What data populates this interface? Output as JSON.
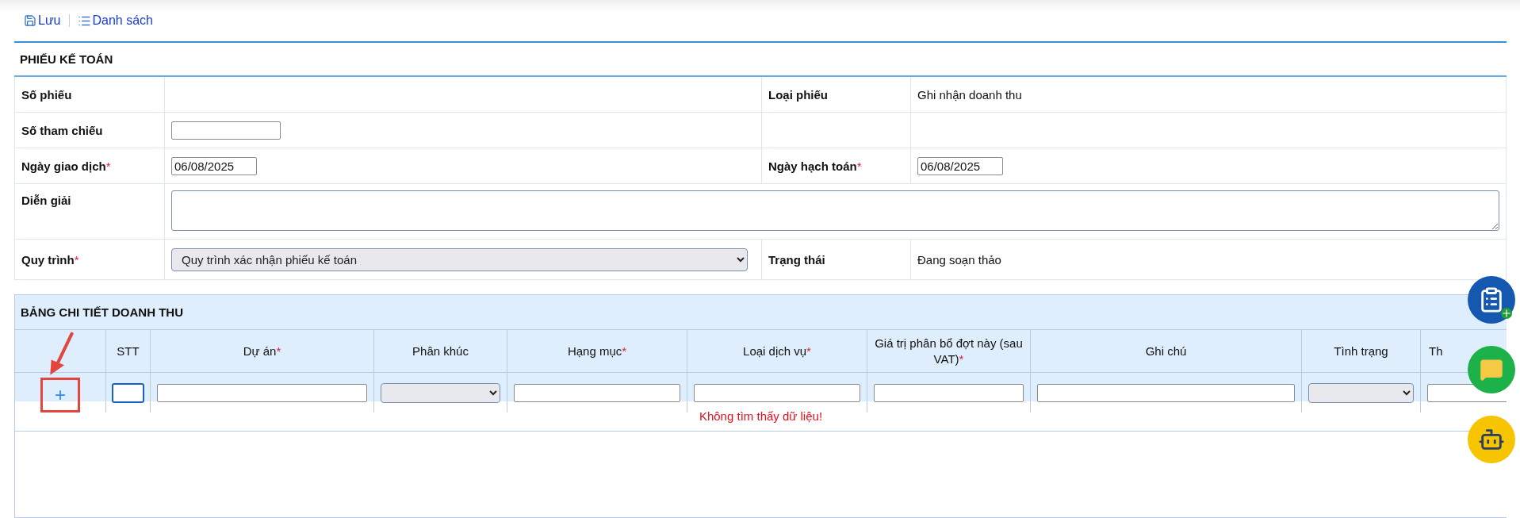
{
  "toolbar": [
    {
      "kind": "save",
      "label": "Lưu"
    },
    {
      "kind": "list",
      "label": "Danh sách"
    }
  ],
  "required_mark": "*",
  "form": {
    "title": "PHIẾU KẾ TOÁN",
    "rows": [
      {
        "kind": "pair",
        "left": {
          "label": "Số phiếu",
          "required": false,
          "kind": "text"
        },
        "right": {
          "label": "Loại phiếu",
          "required": false,
          "kind": "text",
          "value": "Ghi nhận doanh thu"
        }
      },
      {
        "kind": "pair",
        "left": {
          "label": "Số tham chiếu",
          "required": false,
          "kind": "input"
        }
      },
      {
        "kind": "pair",
        "left": {
          "label": "Ngày giao dịch",
          "required": true,
          "kind": "input",
          "value": "06/08/2025"
        },
        "right": {
          "label": "Ngày hạch toán",
          "required": true,
          "kind": "input",
          "value": "06/08/2025"
        }
      },
      {
        "kind": "wide",
        "left": {
          "label": "Diễn giải",
          "required": false,
          "kind": "textarea"
        }
      },
      {
        "kind": "pair",
        "left": {
          "label": "Quy trình",
          "required": true,
          "kind": "select",
          "value": "Quy trình xác nhận phiếu kế toán"
        },
        "right": {
          "label": "Trạng thái",
          "required": false,
          "kind": "text",
          "value": "Đang soạn thảo"
        }
      }
    ]
  },
  "table": {
    "title": "BẢNG CHI TIẾT DOANH THU",
    "columns": [
      {
        "kind": "add",
        "button": "+",
        "highlighted": true
      },
      {
        "label": "STT",
        "required": false,
        "kind": "input",
        "focused": true
      },
      {
        "label": "Dự án",
        "required": true,
        "kind": "input",
        "focused": false
      },
      {
        "label": "Phân khúc",
        "required": false,
        "kind": "select"
      },
      {
        "label": "Hạng mục",
        "required": true,
        "kind": "input",
        "focused": false
      },
      {
        "label": "Loại dịch vụ",
        "required": true,
        "kind": "input",
        "focused": false
      },
      {
        "label": "Giá trị phân bổ đợt này (sau VAT)",
        "required": true,
        "kind": "input",
        "focused": false
      },
      {
        "label": "Ghi chú",
        "required": false,
        "kind": "input",
        "focused": false
      },
      {
        "label": "Tình trạng",
        "required": false,
        "kind": "select"
      },
      {
        "label": "Th",
        "required": false,
        "kind": "input",
        "focused": false,
        "cut": true
      }
    ],
    "empty_message": "Không tìm thấy dữ liệu!"
  },
  "floating_buttons": [
    {
      "kind": "clipboard"
    },
    {
      "kind": "chat"
    },
    {
      "kind": "robot"
    }
  ]
}
